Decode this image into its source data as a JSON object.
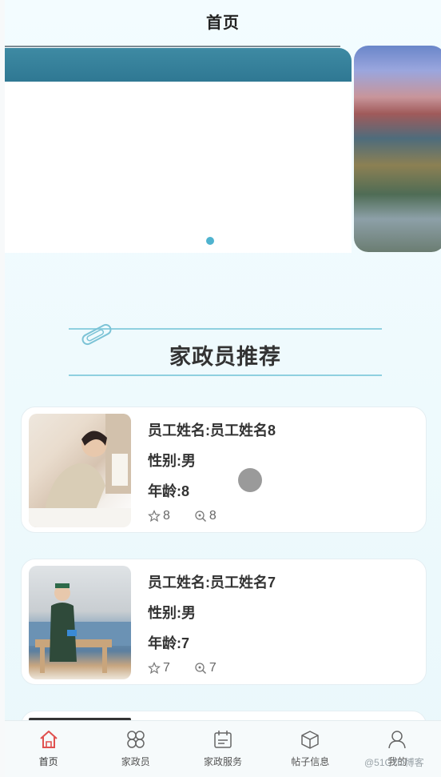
{
  "header": {
    "title": "首页"
  },
  "banner": {
    "active_index": 0,
    "dot_count": 1
  },
  "section": {
    "title": "家政员推荐"
  },
  "cards": [
    {
      "name_line": "员工姓名:员工姓名8",
      "gender_line": "性别:男",
      "age_line": "年龄:8",
      "likes": "8",
      "views": "8"
    },
    {
      "name_line": "员工姓名:员工姓名7",
      "gender_line": "性别:男",
      "age_line": "年龄:7",
      "likes": "7",
      "views": "7"
    }
  ],
  "tabs": [
    {
      "label": "首页",
      "icon": "home-icon",
      "active": true
    },
    {
      "label": "家政员",
      "icon": "grid-icon",
      "active": false
    },
    {
      "label": "家政服务",
      "icon": "calendar-icon",
      "active": false
    },
    {
      "label": "帖子信息",
      "icon": "box-icon",
      "active": false
    },
    {
      "label": "我的",
      "icon": "user-icon",
      "active": false
    }
  ],
  "watermark": "@51CTO博客",
  "colors": {
    "accent": "#4fb3cf",
    "active_tab": "#e0514f",
    "line": "#8fd0e0"
  }
}
